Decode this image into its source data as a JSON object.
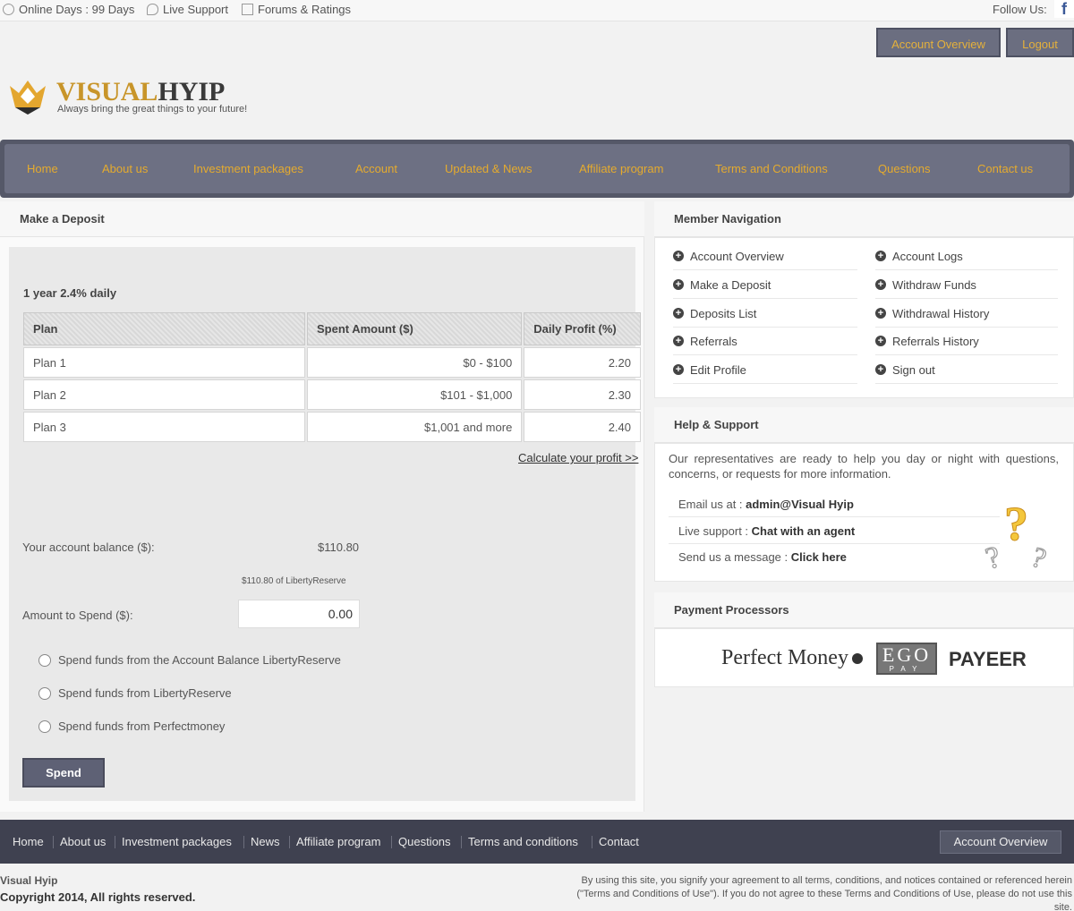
{
  "topbar": {
    "online_days": "Online Days : 99 Days",
    "live_support": "Live Support",
    "forums": "Forums & Ratings",
    "follow_us": "Follow Us:",
    "facebook_glyph": "f"
  },
  "header": {
    "account_overview": "Account Overview",
    "logout": "Logout",
    "logo_part1": "VISUAL",
    "logo_part2": "HYIP",
    "tagline": "Always bring the great things to your future!"
  },
  "nav": {
    "items": [
      "Home",
      "About us",
      "Investment packages",
      "Account",
      "Updated & News",
      "Affiliate program",
      "Terms and Conditions",
      "Questions",
      "Contact us"
    ]
  },
  "deposit": {
    "heading": "Make a Deposit",
    "plan_title": "1 year 2.4% daily",
    "columns": [
      "Plan",
      "Spent Amount ($)",
      "Daily Profit (%)"
    ],
    "rows": [
      [
        "Plan 1",
        "$0 - $100",
        "2.20"
      ],
      [
        "Plan 2",
        "$101 - $1,000",
        "2.30"
      ],
      [
        "Plan 3",
        "$1,001 and more",
        "2.40"
      ]
    ],
    "calc_link": "Calculate your profit >>",
    "balance_label": "Your account balance ($):",
    "balance_value": "$110.80",
    "balance_note": "$110.80 of LibertyReserve",
    "amount_label": "Amount to Spend ($):",
    "amount_value": "0.00",
    "radio_options": [
      "Spend funds from the Account Balance LibertyReserve",
      "Spend funds from LibertyReserve",
      "Spend funds from Perfectmoney"
    ],
    "spend_button": "Spend"
  },
  "member_nav": {
    "heading": "Member Navigation",
    "left": [
      "Account Overview",
      "Make a Deposit",
      "Deposits List",
      "Referrals",
      "Edit Profile"
    ],
    "right": [
      "Account Logs",
      "Withdraw Funds",
      "Withdrawal History",
      "Referrals History",
      "Sign out"
    ]
  },
  "help": {
    "heading": "Help & Support",
    "intro": "Our representatives are ready to help you day or night with questions, concerns, or requests for more information.",
    "email_label": "Email us at : ",
    "email_value": "admin@Visual Hyip",
    "live_label": "Live support : ",
    "live_value": "Chat with an agent",
    "message_label": "Send us a message : ",
    "message_value": "Click here"
  },
  "payment": {
    "heading": "Payment Processors",
    "perfect_money": "Perfect Money",
    "ego_top": "EGO",
    "ego_bottom": "PAY",
    "payeer": "PAYEER"
  },
  "footer": {
    "links": [
      "Home",
      "About us",
      "Investment packages",
      "News",
      "Affiliate program",
      "Questions",
      "Terms and conditions",
      "Contact"
    ],
    "account_overview": "Account Overview",
    "site_name": "Visual Hyip",
    "copyright": "Copyright 2014, All rights reserved.",
    "legal": "By using this site, you signify your agreement to all terms, conditions, and notices contained or referenced herein (\"Terms and Conditions of Use\"). If you do not agree to these Terms and Conditions of Use, please do not use this site."
  }
}
